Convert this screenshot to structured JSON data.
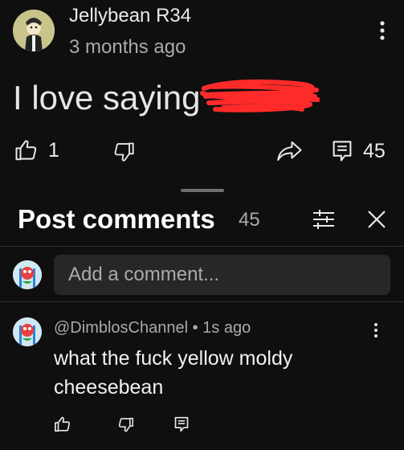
{
  "post": {
    "author": "Jellybean R34",
    "time": "3 months ago",
    "text": "I love saying",
    "likes": "1",
    "replies": "45"
  },
  "sheet": {
    "title": "Post comments",
    "count": "45",
    "add_placeholder": "Add a comment..."
  },
  "comment": {
    "author": "@DimblosChannel",
    "separator": " • ",
    "time": "1s ago",
    "text": "what the fuck yellow moldy cheesebean"
  },
  "colors": {
    "background": "#0f0f0f",
    "input_bg": "#272727",
    "redaction": "#ff2b2b",
    "avatar_main": "#c8c489"
  },
  "icons": [
    "like-icon",
    "dislike-icon",
    "share-icon",
    "reply-icon",
    "more-vert-icon",
    "filter-icon",
    "close-icon"
  ]
}
